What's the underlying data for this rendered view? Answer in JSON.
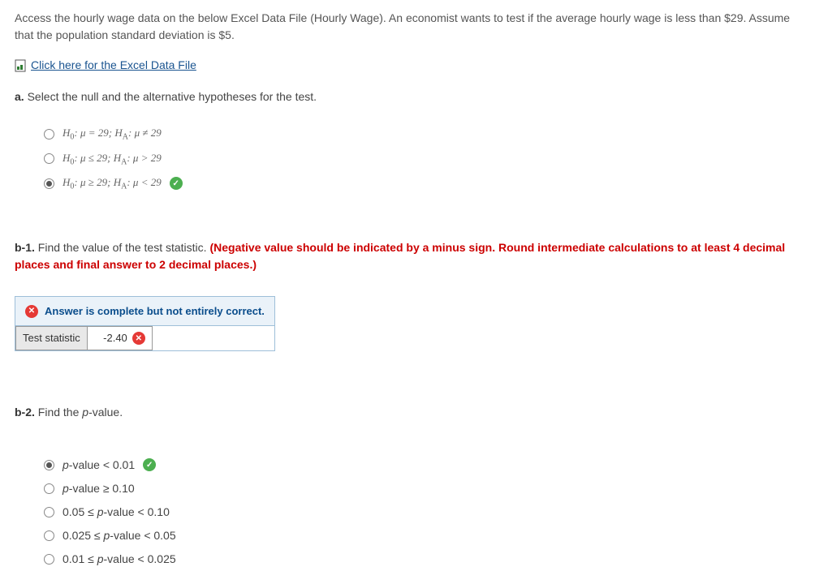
{
  "intro": "Access the hourly wage data on the below Excel Data File (Hourly Wage). An economist wants to test if the average hourly wage is less than $29. Assume that the population standard deviation is $5.",
  "file_link": "Click here for the Excel Data File",
  "part_a": {
    "prefix": "a.",
    "prompt": " Select the null and the alternative hypotheses for the test.",
    "options": [
      {
        "label_html": "H<sub>0</sub>: μ = 29; H<sub>A</sub>: μ ≠ 29",
        "selected": false,
        "correct": false
      },
      {
        "label_html": "H<sub>0</sub>: μ ≤ 29; H<sub>A</sub>: μ > 29",
        "selected": false,
        "correct": false
      },
      {
        "label_html": "H<sub>0</sub>: μ ≥ 29; H<sub>A</sub>: μ < 29",
        "selected": true,
        "correct": true
      }
    ]
  },
  "part_b1": {
    "prefix": "b-1.",
    "prompt": " Find the value of the test statistic. ",
    "red_note": "(Negative value should be indicated by a minus sign. Round intermediate calculations to at least 4 decimal places and final answer to 2 decimal places.)",
    "feedback": "Answer is complete but not entirely correct.",
    "row_label": "Test statistic",
    "value": "-2.40"
  },
  "part_b2": {
    "prefix": "b-2.",
    "prompt_prefix": " Find the ",
    "prompt_italic": "p",
    "prompt_suffix": "-value.",
    "options": [
      {
        "label_html": "<i>p</i>-value < 0.01",
        "selected": true,
        "correct": true
      },
      {
        "label_html": "<i>p</i>-value ≥ 0.10",
        "selected": false,
        "correct": false
      },
      {
        "label_html": "0.05 ≤ <i>p</i>-value < 0.10",
        "selected": false,
        "correct": false
      },
      {
        "label_html": "0.025 ≤ <i>p</i>-value < 0.05",
        "selected": false,
        "correct": false
      },
      {
        "label_html": "0.01 ≤ <i>p</i>-value < 0.025",
        "selected": false,
        "correct": false
      }
    ]
  }
}
